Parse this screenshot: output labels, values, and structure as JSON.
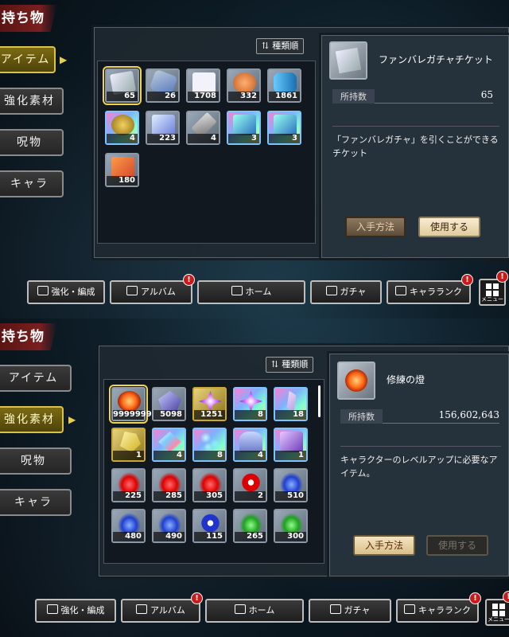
{
  "screens": [
    {
      "title": "持ち物",
      "sidebar": [
        "アイテム",
        "強化素材",
        "呪物",
        "キャラ"
      ],
      "active_tab": "アイテム",
      "sort_label": "種類順",
      "items": [
        {
          "icon": "ticket-icon",
          "count": "65",
          "rarity": "silver",
          "selected": true
        },
        {
          "icon": "shovel-icon",
          "count": "26",
          "rarity": "silver"
        },
        {
          "icon": "dice-icon",
          "count": "1708",
          "rarity": "silver"
        },
        {
          "icon": "leaves-icon",
          "count": "332",
          "rarity": "silver"
        },
        {
          "icon": "cylinder-icon",
          "count": "1861",
          "rarity": "silver"
        },
        {
          "icon": "medal-icon",
          "count": "4",
          "rarity": "rainbow"
        },
        {
          "icon": "gem-pile-icon",
          "count": "223",
          "rarity": "silver"
        },
        {
          "icon": "sword-icon",
          "count": "4",
          "rarity": "silver"
        },
        {
          "icon": "card-icon",
          "count": "3",
          "rarity": "rainbow"
        },
        {
          "icon": "card-icon",
          "count": "3",
          "rarity": "rainbow"
        },
        {
          "icon": "orange-card-icon",
          "count": "180",
          "rarity": "silver"
        }
      ],
      "detail": {
        "name": "ファンバレガチャチケット",
        "own_label": "所持数",
        "own_value": "65",
        "description": "「ファンバレガチャ」を引くことができるチケット",
        "obtain_label": "入手方法",
        "use_label": "使用する"
      }
    },
    {
      "title": "持ち物",
      "sidebar": [
        "アイテム",
        "強化素材",
        "呪物",
        "キャラ"
      ],
      "active_tab": "強化素材",
      "sort_label": "種類順",
      "items": [
        {
          "icon": "fire-orb-icon",
          "count": "99999999",
          "rarity": "silver",
          "selected": true
        },
        {
          "icon": "crystal-icon",
          "count": "5098",
          "rarity": "silver"
        },
        {
          "icon": "burst-crystal-icon",
          "count": "1251",
          "rarity": "gold"
        },
        {
          "icon": "burst-crystal-icon",
          "count": "8",
          "rarity": "rainbow"
        },
        {
          "icon": "shard-icon",
          "count": "18",
          "rarity": "rainbow"
        },
        {
          "icon": "yellow-gem-icon",
          "count": "1",
          "rarity": "gold"
        },
        {
          "icon": "prism-gem-icon",
          "count": "4",
          "rarity": "rainbow"
        },
        {
          "icon": "pieces-icon",
          "count": "8",
          "rarity": "rainbow"
        },
        {
          "icon": "hand-icon",
          "count": "4",
          "rarity": "rainbow"
        },
        {
          "icon": "book-icon",
          "count": "1",
          "rarity": "rainbow"
        },
        {
          "icon": "red-flame-icon",
          "count": "225",
          "rarity": "silver"
        },
        {
          "icon": "red-flame-icon",
          "count": "285",
          "rarity": "silver"
        },
        {
          "icon": "red-flame-icon",
          "count": "305",
          "rarity": "silver"
        },
        {
          "icon": "red-box-icon",
          "count": "2",
          "rarity": "silver"
        },
        {
          "icon": "blue-flame-icon",
          "count": "510",
          "rarity": "silver"
        },
        {
          "icon": "blue-flame-icon",
          "count": "480",
          "rarity": "silver"
        },
        {
          "icon": "blue-flame-icon",
          "count": "490",
          "rarity": "silver"
        },
        {
          "icon": "blue-box-icon",
          "count": "115",
          "rarity": "silver"
        },
        {
          "icon": "green-flame-icon",
          "count": "265",
          "rarity": "silver"
        },
        {
          "icon": "green-flame-icon",
          "count": "300",
          "rarity": "silver"
        }
      ],
      "detail": {
        "name": "修練の燈",
        "own_label": "所持数",
        "own_value": "156,602,643",
        "description": "キャラクターのレベルアップに必要なアイテム。",
        "obtain_label": "入手方法",
        "use_label": "使用する"
      }
    }
  ],
  "bottom_nav": [
    {
      "label": "強化・編成",
      "icon": "team-icon",
      "badge": false
    },
    {
      "label": "アルバム",
      "icon": "album-icon",
      "badge": true
    },
    {
      "label": "ホーム",
      "icon": "home-icon",
      "badge": false
    },
    {
      "label": "ガチャ",
      "icon": "gacha-icon",
      "badge": false
    },
    {
      "label": "キャラランク",
      "icon": "chara-rank-icon",
      "badge": true
    }
  ],
  "menu_label": "メニュー",
  "badge_mark": "!",
  "colors": {
    "accent_gold": "#d8c24a",
    "title_red": "#7a1f1f",
    "badge_red": "#c81c1c"
  }
}
